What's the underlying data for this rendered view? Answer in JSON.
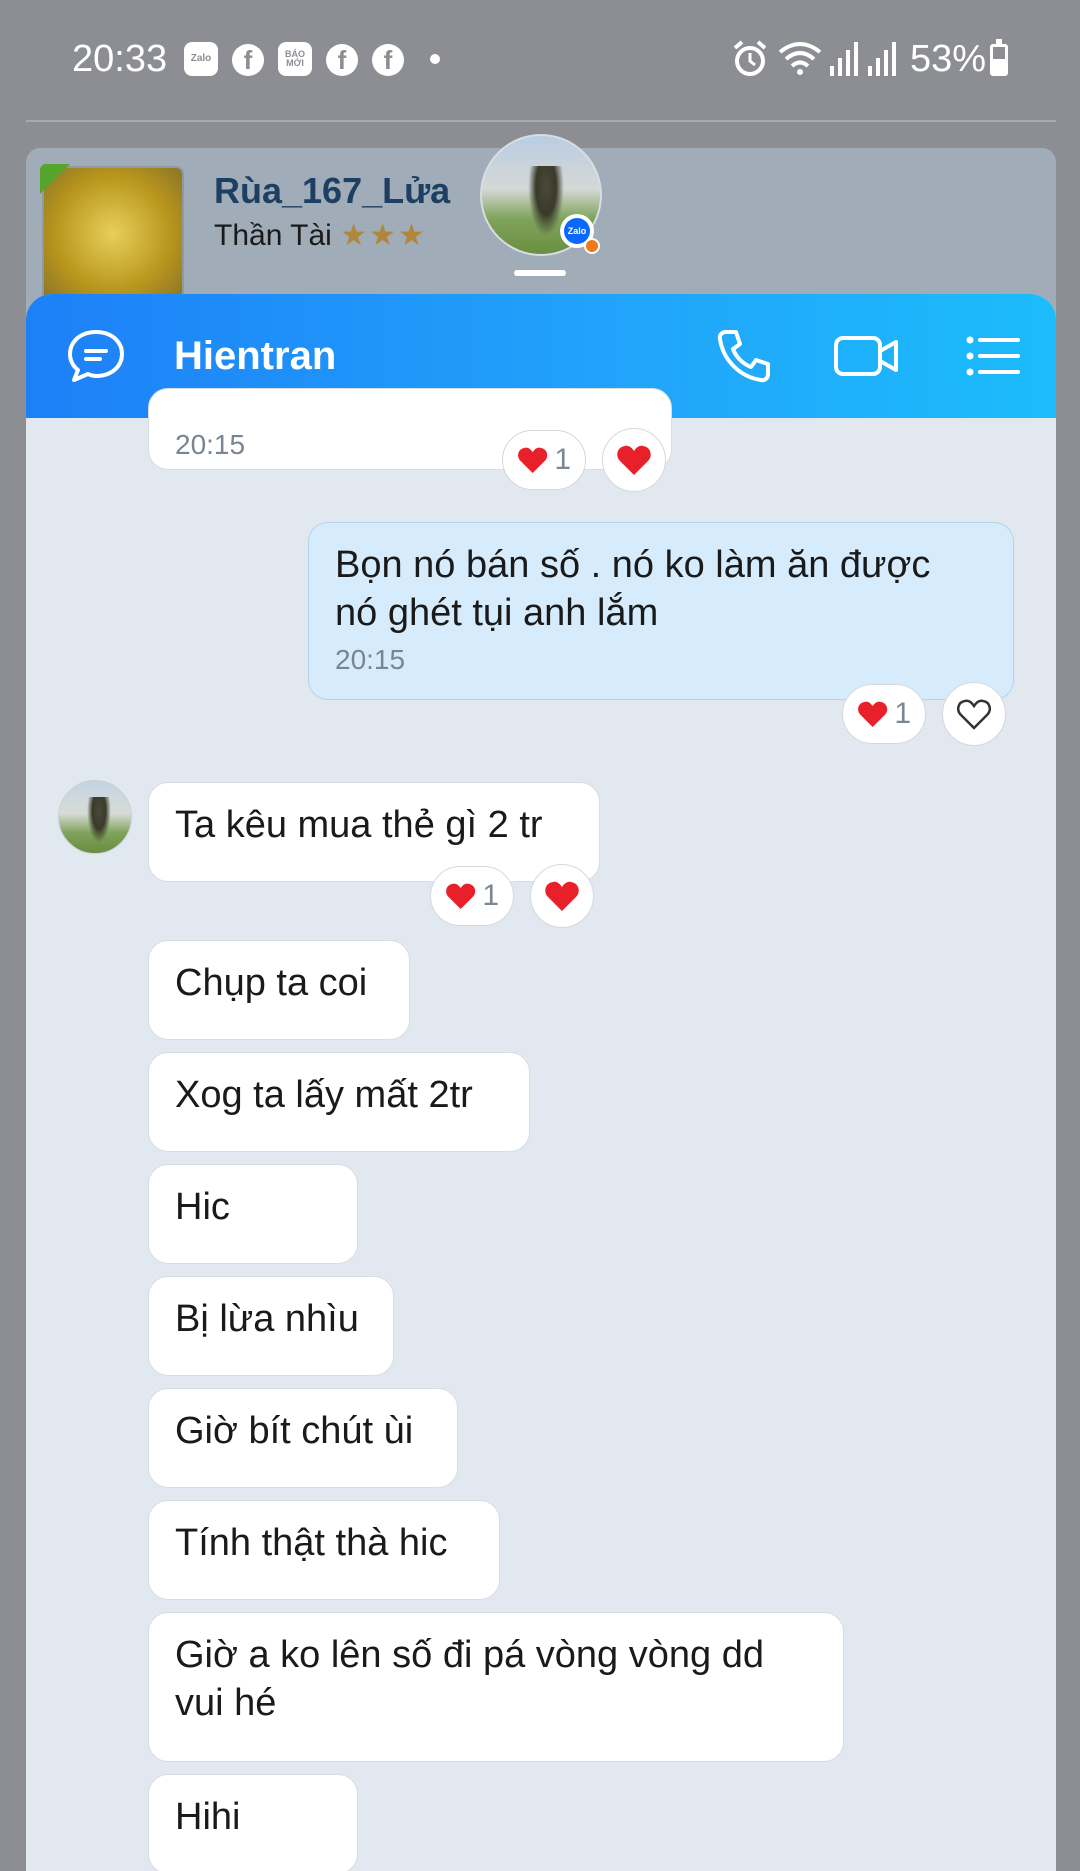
{
  "status_bar": {
    "time": "20:33",
    "notification_icons": [
      "zalo-icon",
      "facebook-icon",
      "baomoi-icon",
      "facebook-icon",
      "facebook-icon"
    ],
    "zalo_label": "Zalo",
    "baomoi_label": "BÁO MỚI",
    "battery": "53%",
    "battery_level": 0.53
  },
  "profile_card": {
    "name": "Rùa_167_Lửa",
    "subtitle": "Thần Tài",
    "stars": "★★★"
  },
  "chat": {
    "header": {
      "title": "Hientran",
      "icons": [
        "chat-bubble-icon",
        "phone-icon",
        "video-call-icon",
        "menu-list-icon"
      ]
    },
    "partial_message": {
      "time": "20:15",
      "reaction_count": "1"
    },
    "messages": [
      {
        "from": "me",
        "text_line1": "Bọn nó bán số . nó ko làm ăn được",
        "text_line2": "nó ghét tụi anh lắm",
        "time": "20:15",
        "reaction_count": "1"
      },
      {
        "from": "other",
        "text": "Ta kêu mua thẻ gì 2 tr",
        "reaction_count": "1"
      },
      {
        "from": "other",
        "text": "Chụp ta coi"
      },
      {
        "from": "other",
        "text": "Xog ta lấy mất 2tr"
      },
      {
        "from": "other",
        "text": "Hic"
      },
      {
        "from": "other",
        "text": "Bị lừa nhìu"
      },
      {
        "from": "other",
        "text": "Giờ bít chút ùi"
      },
      {
        "from": "other",
        "text": "Tính thật thà hic"
      },
      {
        "from": "other",
        "text_line1": "Giờ a ko lên số đi pá vòng vòng dd",
        "text_line2": "vui hé"
      },
      {
        "from": "other",
        "text": "Hihi"
      }
    ]
  },
  "colors": {
    "header_gradient_start": "#1d80f7",
    "header_gradient_end": "#1cbcfb",
    "my_bubble": "#d6ecfc",
    "heart": "#e8202a"
  }
}
